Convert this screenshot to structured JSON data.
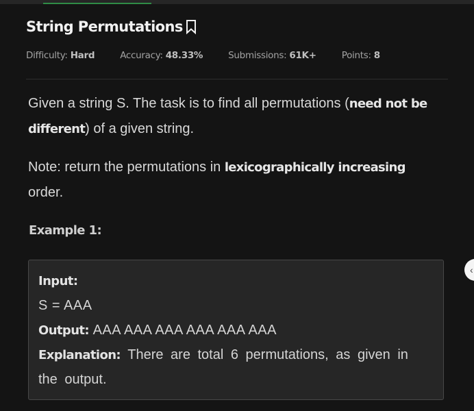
{
  "problem": {
    "title": "String Permutations",
    "meta": {
      "difficulty_label": "Difficulty:",
      "difficulty_value": "Hard",
      "accuracy_label": "Accuracy:",
      "accuracy_value": "48.33%",
      "submissions_label": "Submissions:",
      "submissions_value": "61K+",
      "points_label": "Points:",
      "points_value": "8"
    },
    "description": {
      "p1_a": "Given a string S. The task is to find all permutations (",
      "p1_b": "need not be different",
      "p1_c": ") of a given string.",
      "p2_a": "Note: return the permutations in ",
      "p2_b": "lexicographically increasing",
      "p2_c": " order."
    },
    "example": {
      "heading": "Example 1:",
      "input_label": "Input:",
      "input_value": "S = AAA",
      "output_label": "Output:",
      "output_value": "AAA AAA AAA AAA AAA AAA",
      "explanation_label": "Explanation:",
      "explanation_line1": "There are total 6 permutations, as given in",
      "explanation_line2": "the output."
    }
  },
  "icons": {
    "bookmark": "bookmark-icon",
    "collapse": "chevron-left-icon"
  },
  "colors": {
    "background": "#141414",
    "accent_tab": "#2f8d46",
    "example_box": "#262626"
  }
}
